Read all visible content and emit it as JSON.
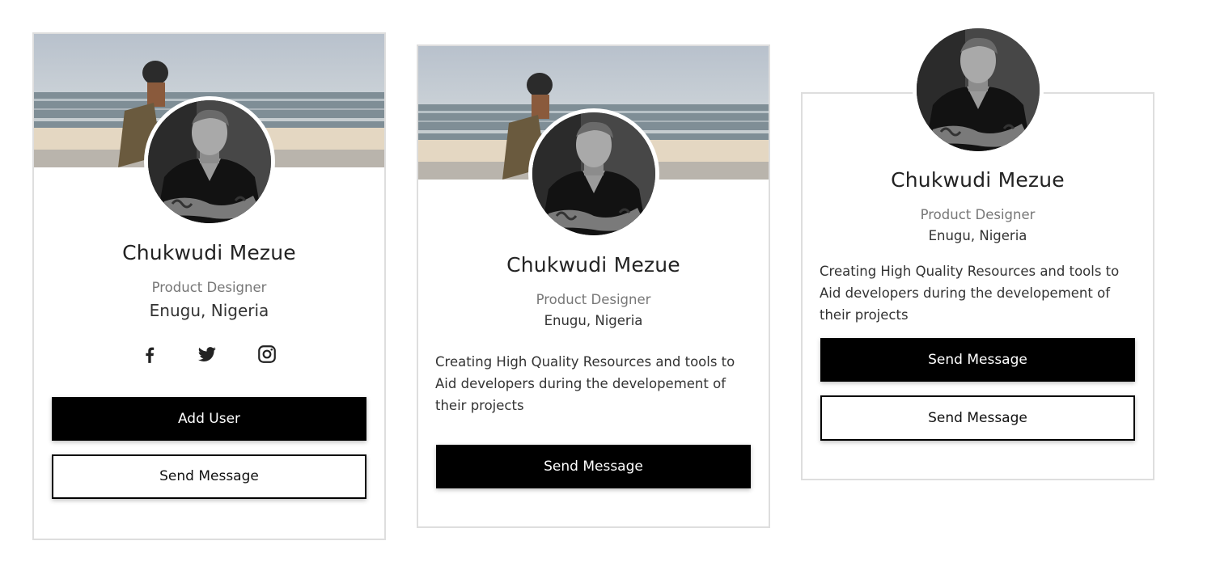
{
  "colors": {
    "primary_button": "#000000",
    "border": "#dedede",
    "secondary_text": "#777777"
  },
  "cards": [
    {
      "name": "Chukwudi Mezue",
      "role": "Product Designer",
      "location": "Enugu, Nigeria",
      "social": [
        "facebook-icon",
        "twitter-icon",
        "instagram-icon"
      ],
      "primary_button": "Add User",
      "secondary_button": "Send Message"
    },
    {
      "name": "Chukwudi Mezue",
      "role": "Product Designer",
      "location": "Enugu, Nigeria",
      "description": "Creating High Quality Resources and tools to Aid developers during the developement of their projects",
      "primary_button": "Send Message"
    },
    {
      "name": "Chukwudi Mezue",
      "role": "Product Designer",
      "location": "Enugu, Nigeria",
      "description": "Creating High Quality Resources and tools to Aid developers during the developement of their projects",
      "primary_button": "Send Message",
      "secondary_button": "Send Message"
    }
  ]
}
